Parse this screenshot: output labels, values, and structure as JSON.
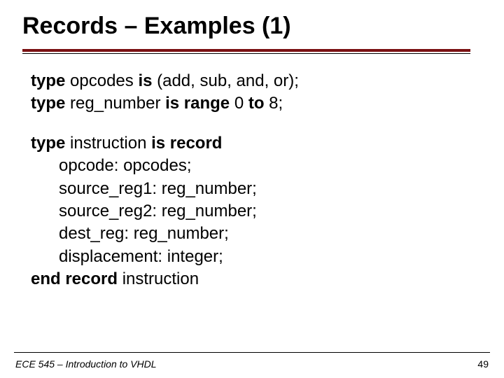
{
  "title": "Records – Examples (1)",
  "code": {
    "l1": {
      "kw1": "type",
      "t1": " opcodes ",
      "kw2": "is",
      "t2": " (add, sub, and, or);"
    },
    "l2": {
      "kw1": "type",
      "t1": " reg_number ",
      "kw2": "is range",
      "t2": " 0 ",
      "kw3": "to",
      "t3": " 8;"
    },
    "l3": {
      "kw1": "type",
      "t1": " instruction ",
      "kw2": "is record"
    },
    "l4": "opcode: opcodes;",
    "l5": "source_reg1: reg_number;",
    "l6": "source_reg2: reg_number;",
    "l7": "dest_reg: reg_number;",
    "l8": "displacement: integer;",
    "l9": {
      "kw1": "end record",
      "t1": " instruction"
    }
  },
  "footer": {
    "left": "ECE 545 – Introduction to VHDL",
    "page": "49"
  }
}
